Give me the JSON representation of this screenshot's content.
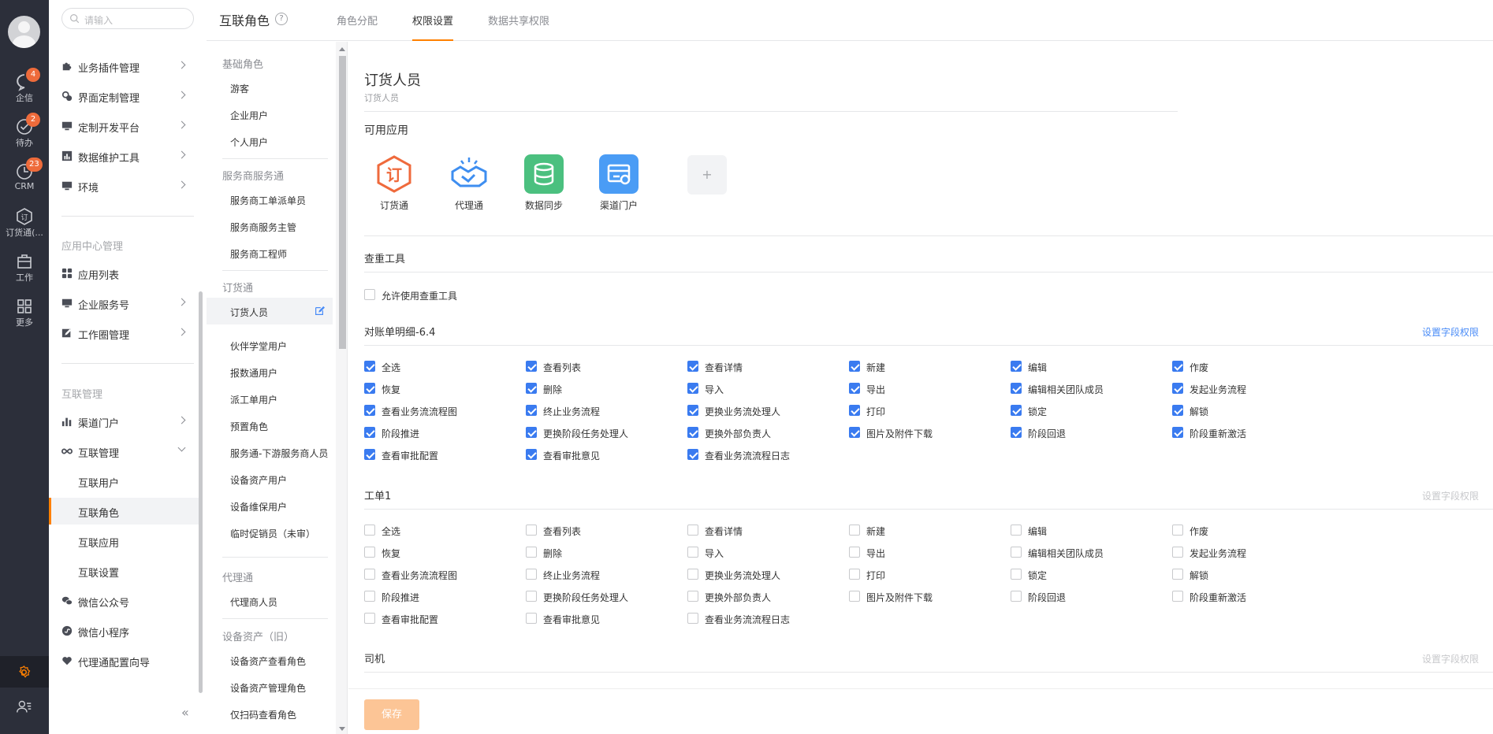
{
  "rail": {
    "items": [
      {
        "label": "企信",
        "badge": "4",
        "icon": "chat-bubble-icon"
      },
      {
        "label": "待办",
        "badge": "2",
        "icon": "check-circle-icon"
      },
      {
        "label": "CRM",
        "badge": "23",
        "icon": "crm-clock-icon"
      },
      {
        "label": "订货通(...",
        "badge": "",
        "icon": "dinghuotong-icon"
      },
      {
        "label": "工作",
        "badge": "",
        "icon": "briefcase-icon"
      },
      {
        "label": "更多",
        "badge": "",
        "icon": "grid-icon"
      }
    ],
    "accent": "#ff8000"
  },
  "menu": {
    "search_placeholder": "请输入",
    "items_top": [
      {
        "label": "业务插件管理",
        "icon": "puzzle-icon"
      },
      {
        "label": "界面定制管理",
        "icon": "palette-icon"
      },
      {
        "label": "定制开发平台",
        "icon": "monitor-icon"
      },
      {
        "label": "数据维护工具",
        "icon": "chart-icon"
      },
      {
        "label": "环境",
        "icon": "monitor-icon"
      }
    ],
    "section_app": "应用中心管理",
    "items_app": [
      {
        "label": "应用列表",
        "icon": "apps-icon"
      },
      {
        "label": "企业服务号",
        "icon": "monitor-icon"
      },
      {
        "label": "工作圈管理",
        "icon": "edit-icon"
      }
    ],
    "section_link": "互联管理",
    "items_link": [
      {
        "label": "渠道门户",
        "icon": "bar-chart-icon"
      },
      {
        "label": "互联管理",
        "icon": "infinity-icon"
      }
    ],
    "sub_items": [
      "互联用户",
      "互联角色",
      "互联应用",
      "互联设置"
    ],
    "items_bottom": [
      {
        "label": "微信公众号",
        "icon": "wechat-icon"
      },
      {
        "label": "微信小程序",
        "icon": "miniprogram-icon"
      },
      {
        "label": "代理通配置向导",
        "icon": "heart-icon"
      }
    ],
    "collapse": "«"
  },
  "header": {
    "title": "互联角色",
    "help": "?",
    "tabs": [
      "角色分配",
      "权限设置",
      "数据共享权限"
    ],
    "selected_tab": 1
  },
  "roles": {
    "groups": [
      {
        "title": "基础角色",
        "items": [
          "游客",
          "企业用户",
          "个人用户"
        ]
      },
      {
        "title": "服务商服务通",
        "items": [
          "服务商工单派单员",
          "服务商服务主管",
          "服务商工程师"
        ]
      },
      {
        "title": "订货通",
        "items": [
          "订货人员",
          "伙伴学堂用户",
          "报数通用户",
          "派工单用户",
          "预置角色",
          "服务通-下游服务商人员",
          "设备资产用户",
          "设备维保用户",
          "临时促销员（未审）"
        ]
      },
      {
        "title": "代理通",
        "items": [
          "代理商人员"
        ]
      },
      {
        "title": "设备资产（旧）",
        "items": [
          "设备资产查看角色",
          "设备资产管理角色",
          "仅扫码查看角色"
        ]
      }
    ],
    "selected": "订货人员"
  },
  "content": {
    "role_title": "订货人员",
    "role_subtitle": "订货人员",
    "available_apps_title": "可用应用",
    "apps": [
      {
        "label": "订货通",
        "color": "#ef6a3c",
        "icon": "dinghuotong-app-icon"
      },
      {
        "label": "代理通",
        "color": "#3e8ef0",
        "icon": "handshake-app-icon"
      },
      {
        "label": "数据同步",
        "color": "#4bc07f",
        "icon": "database-app-icon"
      },
      {
        "label": "渠道门户",
        "color": "#4a9cf5",
        "icon": "portal-app-icon"
      }
    ],
    "add_app": "+",
    "duplicate_tool_title": "查重工具",
    "duplicate_tool_checkbox": "允许使用查重工具",
    "field_perm_link": "设置字段权限",
    "sections": [
      {
        "title": "对账单明细-6.4",
        "enabled": true,
        "checked": true,
        "rows": [
          [
            "全选",
            "查看列表",
            "查看详情",
            "新建",
            "编辑",
            "作废"
          ],
          [
            "恢复",
            "删除",
            "导入",
            "导出",
            "编辑相关团队成员",
            "发起业务流程"
          ],
          [
            "查看业务流流程图",
            "终止业务流程",
            "更换业务流处理人",
            "打印",
            "锁定",
            "解锁"
          ],
          [
            "阶段推进",
            "更换阶段任务处理人",
            "更换外部负责人",
            "图片及附件下载",
            "阶段回退",
            "阶段重新激活"
          ],
          [
            "查看审批配置",
            "查看审批意见",
            "查看业务流流程日志"
          ]
        ]
      },
      {
        "title": "工单1",
        "enabled": false,
        "checked": false,
        "rows": [
          [
            "全选",
            "查看列表",
            "查看详情",
            "新建",
            "编辑",
            "作废"
          ],
          [
            "恢复",
            "删除",
            "导入",
            "导出",
            "编辑相关团队成员",
            "发起业务流程"
          ],
          [
            "查看业务流流程图",
            "终止业务流程",
            "更换业务流处理人",
            "打印",
            "锁定",
            "解锁"
          ],
          [
            "阶段推进",
            "更换阶段任务处理人",
            "更换外部负责人",
            "图片及附件下载",
            "阶段回退",
            "阶段重新激活"
          ],
          [
            "查看审批配置",
            "查看审批意见",
            "查看业务流流程日志"
          ]
        ]
      },
      {
        "title": "司机",
        "enabled": false,
        "checked": false,
        "rows": []
      }
    ],
    "save_label": "保存"
  }
}
